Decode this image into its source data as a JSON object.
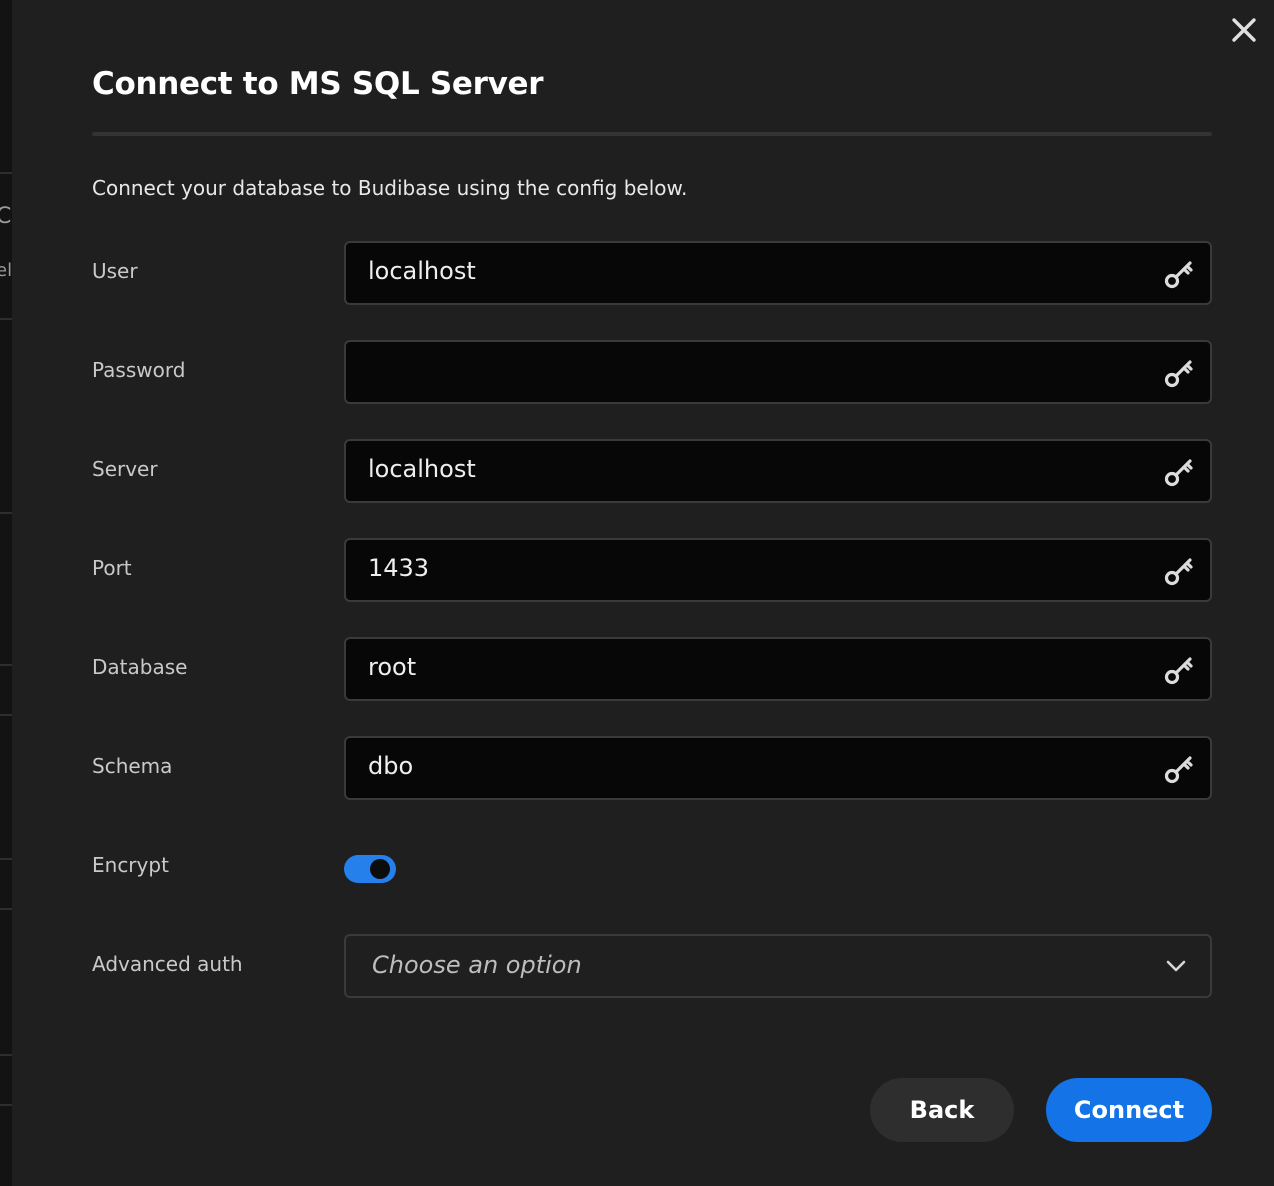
{
  "modal": {
    "title": "Connect to MS SQL Server",
    "description": "Connect your database to Budibase using the config below."
  },
  "backdrop": {
    "peek_text_1": "Cr",
    "peek_text_2": "ela"
  },
  "fields": [
    {
      "label": "User",
      "value": "localhost",
      "icon": "key-icon"
    },
    {
      "label": "Password",
      "value": "",
      "icon": "key-icon"
    },
    {
      "label": "Server",
      "value": "localhost",
      "icon": "key-icon"
    },
    {
      "label": "Port",
      "value": "1433",
      "icon": "key-icon"
    },
    {
      "label": "Database",
      "value": "root",
      "icon": "key-icon"
    },
    {
      "label": "Schema",
      "value": "dbo",
      "icon": "key-icon"
    }
  ],
  "encrypt": {
    "label": "Encrypt",
    "enabled": true
  },
  "advanced_auth": {
    "label": "Advanced auth",
    "placeholder": "Choose an option"
  },
  "buttons": {
    "back_label": "Back",
    "connect_label": "Connect"
  },
  "colors": {
    "accent": "#1473e6",
    "toggle_on": "#2680eb",
    "background": "#1f1f1f"
  }
}
